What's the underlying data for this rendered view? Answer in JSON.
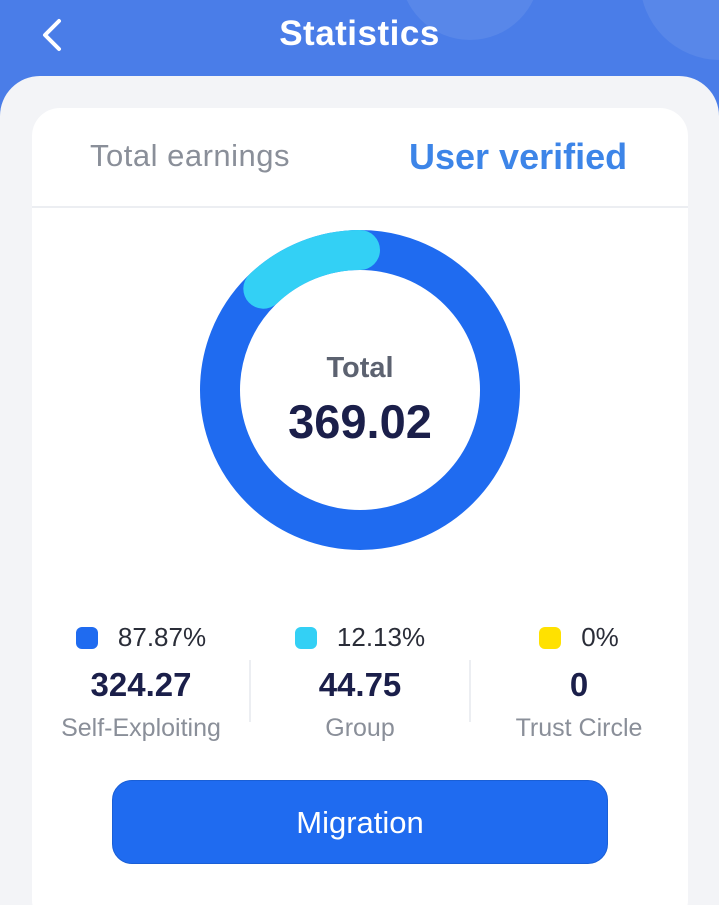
{
  "header": {
    "title": "Statistics",
    "back_icon": "chevron-left-icon",
    "bg_color": "#4a7de8"
  },
  "tabs": [
    {
      "label": "Total earnings",
      "active": false
    },
    {
      "label": "User verified",
      "active": true
    }
  ],
  "chart_data": {
    "type": "pie",
    "center_label": "Total",
    "center_value": "369.02",
    "series": [
      {
        "name": "Self-Exploiting",
        "percent": 87.87,
        "value": 324.27,
        "color": "#1f6bf0"
      },
      {
        "name": "Group",
        "percent": 12.13,
        "value": 44.75,
        "color": "#33d0f5"
      },
      {
        "name": "Trust Circle",
        "percent": 0,
        "value": 0,
        "color": "#ffe100"
      }
    ]
  },
  "stats": [
    {
      "percent_text": "87.87%",
      "amount_text": "324.27",
      "label": "Self-Exploiting",
      "color": "#1f6bf0"
    },
    {
      "percent_text": "12.13%",
      "amount_text": "44.75",
      "label": "Group",
      "color": "#33d0f5"
    },
    {
      "percent_text": "0%",
      "amount_text": "0",
      "label": "Trust Circle",
      "color": "#ffe100"
    }
  ],
  "migration_button": {
    "label": "Migration"
  }
}
